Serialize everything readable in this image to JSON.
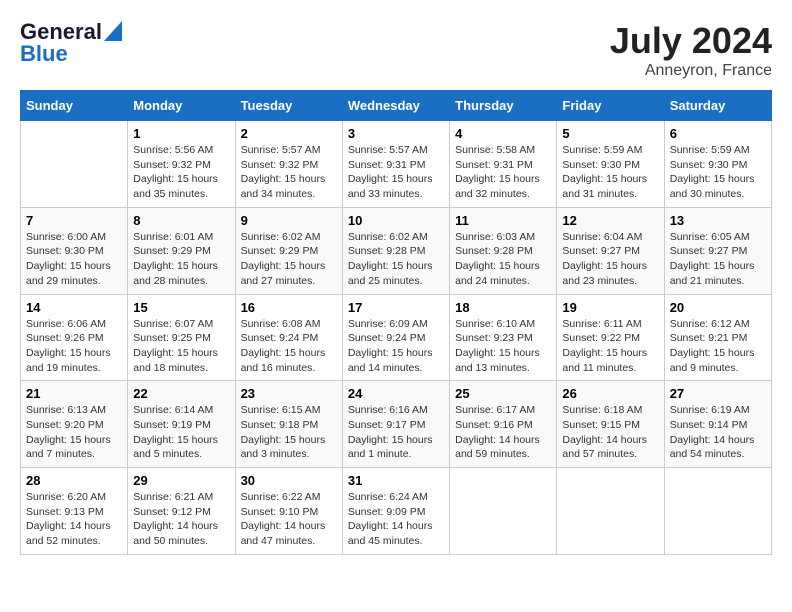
{
  "logo": {
    "line1": "General",
    "line2": "Blue"
  },
  "title": "July 2024",
  "subtitle": "Anneyron, France",
  "days_header": [
    "Sunday",
    "Monday",
    "Tuesday",
    "Wednesday",
    "Thursday",
    "Friday",
    "Saturday"
  ],
  "weeks": [
    [
      {
        "day": "",
        "info": ""
      },
      {
        "day": "1",
        "info": "Sunrise: 5:56 AM\nSunset: 9:32 PM\nDaylight: 15 hours\nand 35 minutes."
      },
      {
        "day": "2",
        "info": "Sunrise: 5:57 AM\nSunset: 9:32 PM\nDaylight: 15 hours\nand 34 minutes."
      },
      {
        "day": "3",
        "info": "Sunrise: 5:57 AM\nSunset: 9:31 PM\nDaylight: 15 hours\nand 33 minutes."
      },
      {
        "day": "4",
        "info": "Sunrise: 5:58 AM\nSunset: 9:31 PM\nDaylight: 15 hours\nand 32 minutes."
      },
      {
        "day": "5",
        "info": "Sunrise: 5:59 AM\nSunset: 9:30 PM\nDaylight: 15 hours\nand 31 minutes."
      },
      {
        "day": "6",
        "info": "Sunrise: 5:59 AM\nSunset: 9:30 PM\nDaylight: 15 hours\nand 30 minutes."
      }
    ],
    [
      {
        "day": "7",
        "info": "Sunrise: 6:00 AM\nSunset: 9:30 PM\nDaylight: 15 hours\nand 29 minutes."
      },
      {
        "day": "8",
        "info": "Sunrise: 6:01 AM\nSunset: 9:29 PM\nDaylight: 15 hours\nand 28 minutes."
      },
      {
        "day": "9",
        "info": "Sunrise: 6:02 AM\nSunset: 9:29 PM\nDaylight: 15 hours\nand 27 minutes."
      },
      {
        "day": "10",
        "info": "Sunrise: 6:02 AM\nSunset: 9:28 PM\nDaylight: 15 hours\nand 25 minutes."
      },
      {
        "day": "11",
        "info": "Sunrise: 6:03 AM\nSunset: 9:28 PM\nDaylight: 15 hours\nand 24 minutes."
      },
      {
        "day": "12",
        "info": "Sunrise: 6:04 AM\nSunset: 9:27 PM\nDaylight: 15 hours\nand 23 minutes."
      },
      {
        "day": "13",
        "info": "Sunrise: 6:05 AM\nSunset: 9:27 PM\nDaylight: 15 hours\nand 21 minutes."
      }
    ],
    [
      {
        "day": "14",
        "info": "Sunrise: 6:06 AM\nSunset: 9:26 PM\nDaylight: 15 hours\nand 19 minutes."
      },
      {
        "day": "15",
        "info": "Sunrise: 6:07 AM\nSunset: 9:25 PM\nDaylight: 15 hours\nand 18 minutes."
      },
      {
        "day": "16",
        "info": "Sunrise: 6:08 AM\nSunset: 9:24 PM\nDaylight: 15 hours\nand 16 minutes."
      },
      {
        "day": "17",
        "info": "Sunrise: 6:09 AM\nSunset: 9:24 PM\nDaylight: 15 hours\nand 14 minutes."
      },
      {
        "day": "18",
        "info": "Sunrise: 6:10 AM\nSunset: 9:23 PM\nDaylight: 15 hours\nand 13 minutes."
      },
      {
        "day": "19",
        "info": "Sunrise: 6:11 AM\nSunset: 9:22 PM\nDaylight: 15 hours\nand 11 minutes."
      },
      {
        "day": "20",
        "info": "Sunrise: 6:12 AM\nSunset: 9:21 PM\nDaylight: 15 hours\nand 9 minutes."
      }
    ],
    [
      {
        "day": "21",
        "info": "Sunrise: 6:13 AM\nSunset: 9:20 PM\nDaylight: 15 hours\nand 7 minutes."
      },
      {
        "day": "22",
        "info": "Sunrise: 6:14 AM\nSunset: 9:19 PM\nDaylight: 15 hours\nand 5 minutes."
      },
      {
        "day": "23",
        "info": "Sunrise: 6:15 AM\nSunset: 9:18 PM\nDaylight: 15 hours\nand 3 minutes."
      },
      {
        "day": "24",
        "info": "Sunrise: 6:16 AM\nSunset: 9:17 PM\nDaylight: 15 hours\nand 1 minute."
      },
      {
        "day": "25",
        "info": "Sunrise: 6:17 AM\nSunset: 9:16 PM\nDaylight: 14 hours\nand 59 minutes."
      },
      {
        "day": "26",
        "info": "Sunrise: 6:18 AM\nSunset: 9:15 PM\nDaylight: 14 hours\nand 57 minutes."
      },
      {
        "day": "27",
        "info": "Sunrise: 6:19 AM\nSunset: 9:14 PM\nDaylight: 14 hours\nand 54 minutes."
      }
    ],
    [
      {
        "day": "28",
        "info": "Sunrise: 6:20 AM\nSunset: 9:13 PM\nDaylight: 14 hours\nand 52 minutes."
      },
      {
        "day": "29",
        "info": "Sunrise: 6:21 AM\nSunset: 9:12 PM\nDaylight: 14 hours\nand 50 minutes."
      },
      {
        "day": "30",
        "info": "Sunrise: 6:22 AM\nSunset: 9:10 PM\nDaylight: 14 hours\nand 47 minutes."
      },
      {
        "day": "31",
        "info": "Sunrise: 6:24 AM\nSunset: 9:09 PM\nDaylight: 14 hours\nand 45 minutes."
      },
      {
        "day": "",
        "info": ""
      },
      {
        "day": "",
        "info": ""
      },
      {
        "day": "",
        "info": ""
      }
    ]
  ]
}
